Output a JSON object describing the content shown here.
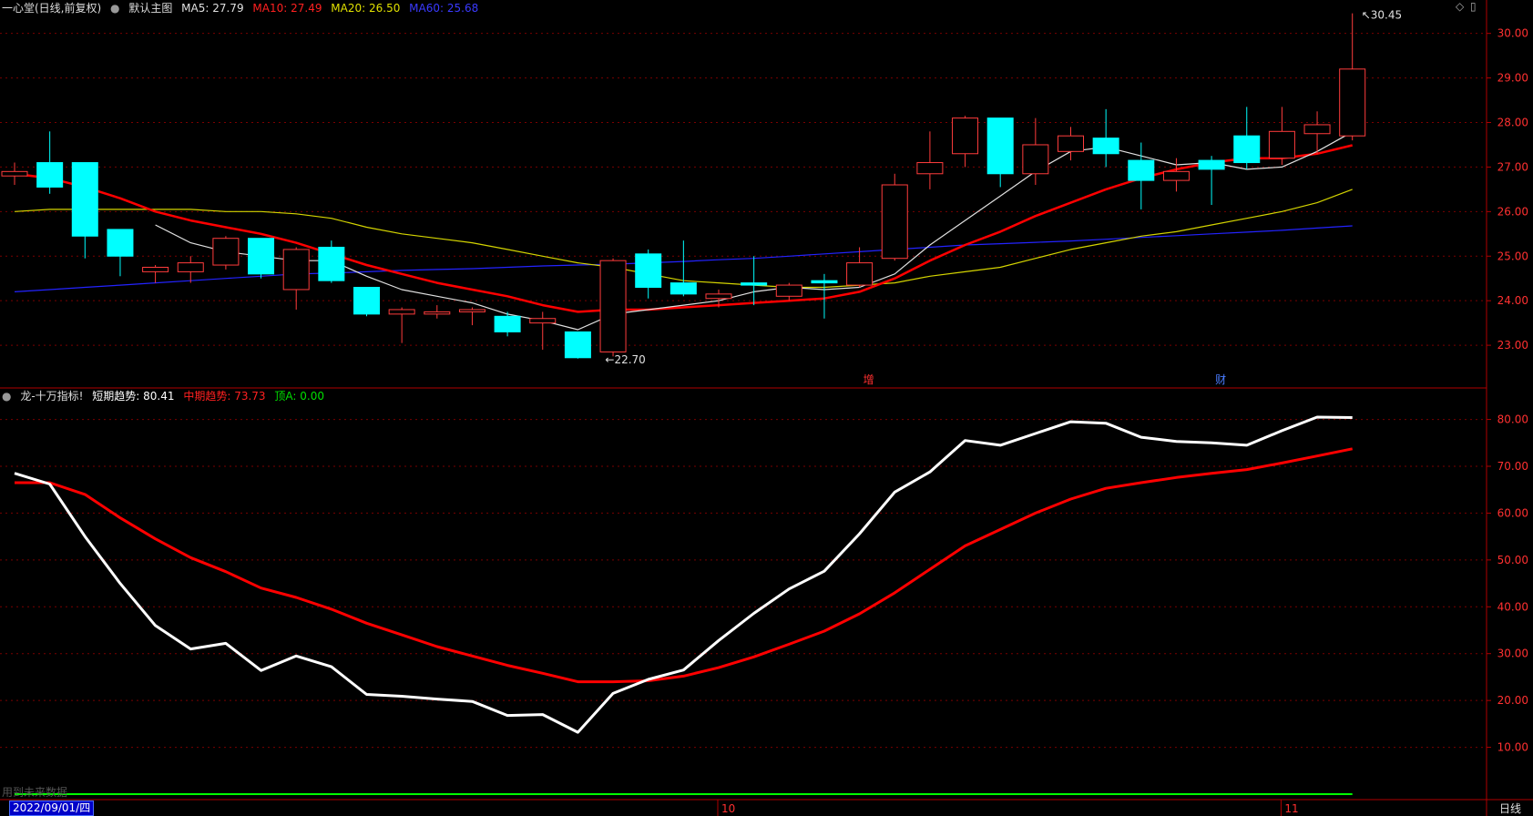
{
  "main_legend": {
    "title": "一心堂(日线,前复权)",
    "theme": "默认主图",
    "ma5": "MA5: 27.79",
    "ma10": "MA10: 27.49",
    "ma20": "MA20: 26.50",
    "ma60": "MA60: 25.68"
  },
  "sub_legend": {
    "title": "龙-十万指标!",
    "short": "短期趋势: 80.41",
    "mid": "中期趋势: 73.73",
    "top": "顶A: 0.00"
  },
  "markers": {
    "high_label": "30.45",
    "low_label": "22.70",
    "zeng": "增",
    "cai": "财"
  },
  "bottom": {
    "date": "2022/09/01/四",
    "oct": "10",
    "nov": "11",
    "period": "日线",
    "watermark_hint": "用到未来数据"
  },
  "colors": {
    "up": "#ff3c3c",
    "down": "#00ffff",
    "ma5": "#e0e0e0",
    "ma10": "#ff0000",
    "ma20": "#d4d400",
    "ma60": "#2323ff",
    "short": "#ffffff",
    "mid": "#ff0000",
    "topA": "#00ff00",
    "grid": "#7a0000"
  },
  "chart_data": [
    {
      "type": "candlestick",
      "title": "一心堂(日线,前复权)",
      "y_ticks": [
        23.0,
        24.0,
        25.0,
        26.0,
        27.0,
        28.0,
        29.0,
        30.0
      ],
      "ylim": [
        22.45,
        30.75
      ],
      "candles": [
        {
          "o": 26.8,
          "h": 27.1,
          "l": 26.6,
          "c": 26.9
        },
        {
          "o": 27.1,
          "h": 27.8,
          "l": 26.4,
          "c": 26.55
        },
        {
          "o": 27.1,
          "h": 27.1,
          "l": 24.95,
          "c": 25.45
        },
        {
          "o": 25.6,
          "h": 25.6,
          "l": 24.55,
          "c": 25.0
        },
        {
          "o": 24.65,
          "h": 24.8,
          "l": 24.4,
          "c": 24.75
        },
        {
          "o": 24.65,
          "h": 25.0,
          "l": 24.4,
          "c": 24.85
        },
        {
          "o": 24.8,
          "h": 25.45,
          "l": 24.7,
          "c": 25.4
        },
        {
          "o": 25.4,
          "h": 25.4,
          "l": 24.5,
          "c": 24.6
        },
        {
          "o": 24.25,
          "h": 25.2,
          "l": 23.8,
          "c": 25.15
        },
        {
          "o": 25.2,
          "h": 25.35,
          "l": 24.4,
          "c": 24.45
        },
        {
          "o": 24.3,
          "h": 24.3,
          "l": 23.65,
          "c": 23.7
        },
        {
          "o": 23.7,
          "h": 23.85,
          "l": 23.05,
          "c": 23.8
        },
        {
          "o": 23.7,
          "h": 23.9,
          "l": 23.6,
          "c": 23.75
        },
        {
          "o": 23.75,
          "h": 23.85,
          "l": 23.45,
          "c": 23.8
        },
        {
          "o": 23.65,
          "h": 23.75,
          "l": 23.2,
          "c": 23.3
        },
        {
          "o": 23.5,
          "h": 23.75,
          "l": 22.9,
          "c": 23.6
        },
        {
          "o": 23.3,
          "h": 23.3,
          "l": 22.7,
          "c": 22.72
        },
        {
          "o": 22.85,
          "h": 24.95,
          "l": 22.75,
          "c": 24.9
        },
        {
          "o": 25.05,
          "h": 25.15,
          "l": 24.05,
          "c": 24.3
        },
        {
          "o": 24.4,
          "h": 25.35,
          "l": 24.1,
          "c": 24.15
        },
        {
          "o": 24.05,
          "h": 24.25,
          "l": 23.85,
          "c": 24.15
        },
        {
          "o": 24.4,
          "h": 25.0,
          "l": 23.9,
          "c": 24.35
        },
        {
          "o": 24.1,
          "h": 24.4,
          "l": 24.0,
          "c": 24.35
        },
        {
          "o": 24.45,
          "h": 24.6,
          "l": 23.6,
          "c": 24.4
        },
        {
          "o": 24.35,
          "h": 25.2,
          "l": 24.3,
          "c": 24.85
        },
        {
          "o": 24.95,
          "h": 26.85,
          "l": 24.9,
          "c": 26.6
        },
        {
          "o": 26.85,
          "h": 27.8,
          "l": 26.5,
          "c": 27.1
        },
        {
          "o": 27.3,
          "h": 28.15,
          "l": 27.0,
          "c": 28.1
        },
        {
          "o": 28.1,
          "h": 28.1,
          "l": 26.55,
          "c": 26.85
        },
        {
          "o": 26.85,
          "h": 28.1,
          "l": 26.6,
          "c": 27.5
        },
        {
          "o": 27.35,
          "h": 27.9,
          "l": 27.15,
          "c": 27.7
        },
        {
          "o": 27.65,
          "h": 28.3,
          "l": 27.0,
          "c": 27.3
        },
        {
          "o": 27.15,
          "h": 27.55,
          "l": 26.05,
          "c": 26.7
        },
        {
          "o": 26.7,
          "h": 27.2,
          "l": 26.45,
          "c": 26.9
        },
        {
          "o": 27.15,
          "h": 27.25,
          "l": 26.15,
          "c": 26.95
        },
        {
          "o": 27.7,
          "h": 28.35,
          "l": 26.95,
          "c": 27.1
        },
        {
          "o": 27.2,
          "h": 28.35,
          "l": 27.05,
          "c": 27.8
        },
        {
          "o": 27.75,
          "h": 28.25,
          "l": 27.3,
          "c": 27.95
        },
        {
          "o": 27.7,
          "h": 30.45,
          "l": 27.6,
          "c": 29.2
        }
      ],
      "ma5": [
        null,
        null,
        null,
        null,
        25.7,
        25.3,
        25.1,
        25.0,
        24.9,
        24.9,
        24.55,
        24.25,
        24.1,
        23.95,
        23.7,
        23.55,
        23.35,
        23.7,
        23.8,
        23.9,
        24.0,
        24.2,
        24.3,
        24.25,
        24.3,
        24.6,
        25.25,
        25.8,
        26.35,
        26.9,
        27.35,
        27.45,
        27.25,
        27.05,
        27.1,
        26.95,
        27.0,
        27.35,
        27.79
      ],
      "ma10": [
        26.85,
        26.75,
        26.55,
        26.3,
        26.0,
        25.8,
        25.65,
        25.5,
        25.3,
        25.05,
        24.8,
        24.6,
        24.4,
        24.25,
        24.1,
        23.9,
        23.75,
        23.8,
        23.8,
        23.85,
        23.9,
        23.95,
        24.0,
        24.05,
        24.2,
        24.5,
        24.9,
        25.25,
        25.55,
        25.9,
        26.2,
        26.5,
        26.75,
        26.95,
        27.1,
        27.2,
        27.2,
        27.3,
        27.49
      ],
      "ma20": [
        26.0,
        26.05,
        26.05,
        26.05,
        26.05,
        26.05,
        26.0,
        26.0,
        25.95,
        25.85,
        25.65,
        25.5,
        25.4,
        25.3,
        25.15,
        25.0,
        24.85,
        24.75,
        24.6,
        24.45,
        24.4,
        24.35,
        24.3,
        24.3,
        24.35,
        24.4,
        24.55,
        24.65,
        24.75,
        24.95,
        25.15,
        25.3,
        25.45,
        25.55,
        25.7,
        25.85,
        26.0,
        26.2,
        26.5
      ],
      "ma60": [
        24.2,
        24.25,
        24.3,
        24.35,
        24.4,
        24.45,
        24.5,
        24.55,
        24.6,
        24.62,
        24.65,
        24.68,
        24.7,
        24.72,
        24.75,
        24.78,
        24.8,
        24.82,
        24.85,
        24.88,
        24.92,
        24.95,
        25.0,
        25.05,
        25.1,
        25.15,
        25.2,
        25.25,
        25.28,
        25.31,
        25.34,
        25.38,
        25.42,
        25.46,
        25.5,
        25.54,
        25.58,
        25.63,
        25.68
      ]
    },
    {
      "type": "line",
      "title": "龙-十万指标!",
      "y_ticks": [
        10.0,
        20.0,
        30.0,
        40.0,
        50.0,
        60.0,
        70.0,
        80.0
      ],
      "ylim": [
        0,
        84
      ],
      "series": [
        {
          "name": "短期趋势",
          "values": [
            68.5,
            66.2,
            55.0,
            45.0,
            36.0,
            31.0,
            32.2,
            26.4,
            29.5,
            27.2,
            21.3,
            20.9,
            20.3,
            19.8,
            16.8,
            17.0,
            13.2,
            21.5,
            24.5,
            26.5,
            32.8,
            38.6,
            43.8,
            47.6,
            55.6,
            64.5,
            68.8,
            75.5,
            74.5,
            77.0,
            79.5,
            79.2,
            76.2,
            75.3,
            75.0,
            74.5,
            77.6,
            80.5,
            80.41
          ]
        },
        {
          "name": "中期趋势",
          "values": [
            66.5,
            66.5,
            64.0,
            59.0,
            54.5,
            50.5,
            47.5,
            44.0,
            42.0,
            39.5,
            36.5,
            34.0,
            31.5,
            29.5,
            27.5,
            25.8,
            24.0,
            24.0,
            24.2,
            25.2,
            27.0,
            29.3,
            32.0,
            34.8,
            38.5,
            43.0,
            48.0,
            53.0,
            56.5,
            60.0,
            63.0,
            65.3,
            66.5,
            67.6,
            68.5,
            69.3,
            70.7,
            72.2,
            73.73
          ]
        },
        {
          "name": "顶A",
          "values": [
            0,
            0,
            0,
            0,
            0,
            0,
            0,
            0,
            0,
            0,
            0,
            0,
            0,
            0,
            0,
            0,
            0,
            0,
            0,
            0,
            0,
            0,
            0,
            0,
            0,
            0,
            0,
            0,
            0,
            0,
            0,
            0,
            0,
            0,
            0,
            0,
            0,
            0,
            0
          ]
        }
      ]
    }
  ]
}
